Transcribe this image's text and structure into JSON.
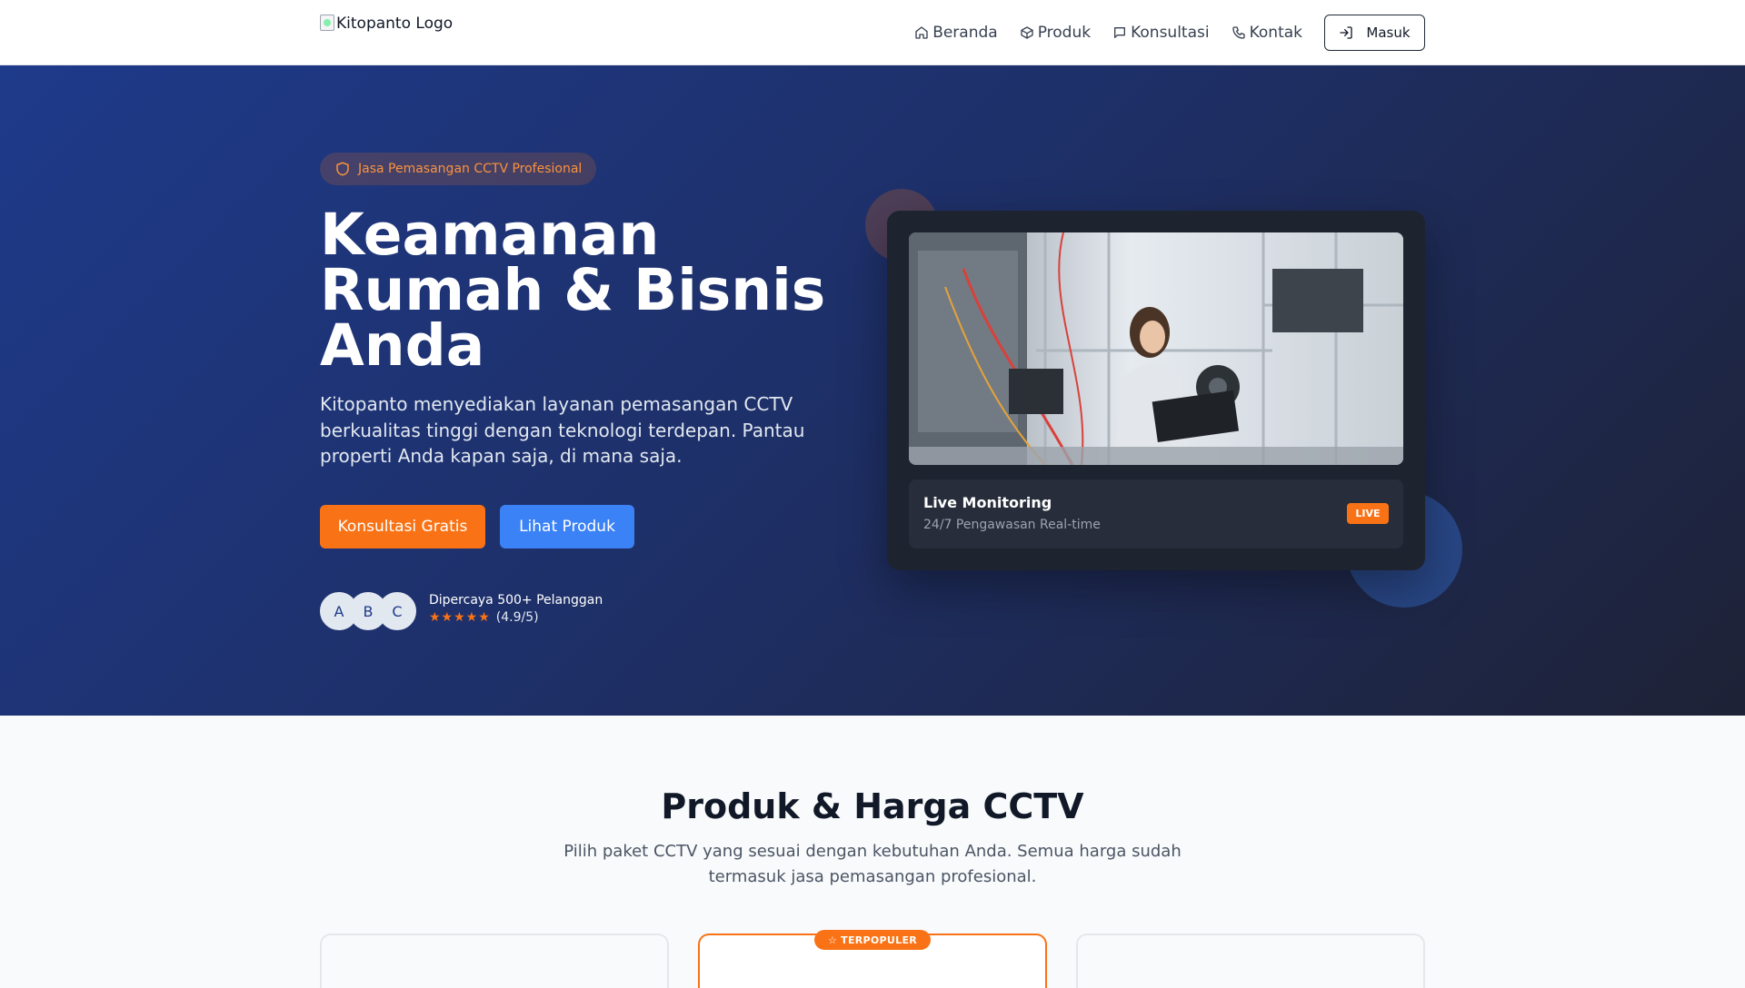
{
  "nav": {
    "logo_alt": "Kitopanto Logo",
    "items": [
      {
        "label": "Beranda",
        "icon": "home-icon"
      },
      {
        "label": "Produk",
        "icon": "box-icon"
      },
      {
        "label": "Konsultasi",
        "icon": "message-icon"
      },
      {
        "label": "Kontak",
        "icon": "phone-icon"
      }
    ],
    "login_label": "Masuk"
  },
  "hero": {
    "badge": "Jasa Pemasangan CCTV Profesional",
    "title": "Keamanan Rumah & Bisnis Anda",
    "description": "Kitopanto menyediakan layanan pemasangan CCTV berkualitas tinggi dengan teknologi terdepan. Pantau properti Anda kapan saja, di mana saja.",
    "cta_primary": "Konsultasi Gratis",
    "cta_secondary": "Lihat Produk",
    "avatars": [
      "A",
      "B",
      "C"
    ],
    "trust_text": "Dipercaya 500+ Pelanggan",
    "rating_text": "(4.9/5)",
    "rating_stars": 5,
    "stars_glyph": "★★★★★",
    "card": {
      "title": "Live Monitoring",
      "subtitle": "24/7 Pengawasan Real-time",
      "badge": "LIVE"
    }
  },
  "products": {
    "title": "Produk & Harga CCTV",
    "subtitle": "Pilih paket CCTV yang sesuai dengan kebutuhan Anda. Semua harga sudah termasuk jasa pemasangan profesional.",
    "popular_badge": "TERPOPULER"
  },
  "colors": {
    "accent_orange": "#f97316",
    "accent_blue": "#3b82f6",
    "hero_dark": "#1e2236"
  }
}
